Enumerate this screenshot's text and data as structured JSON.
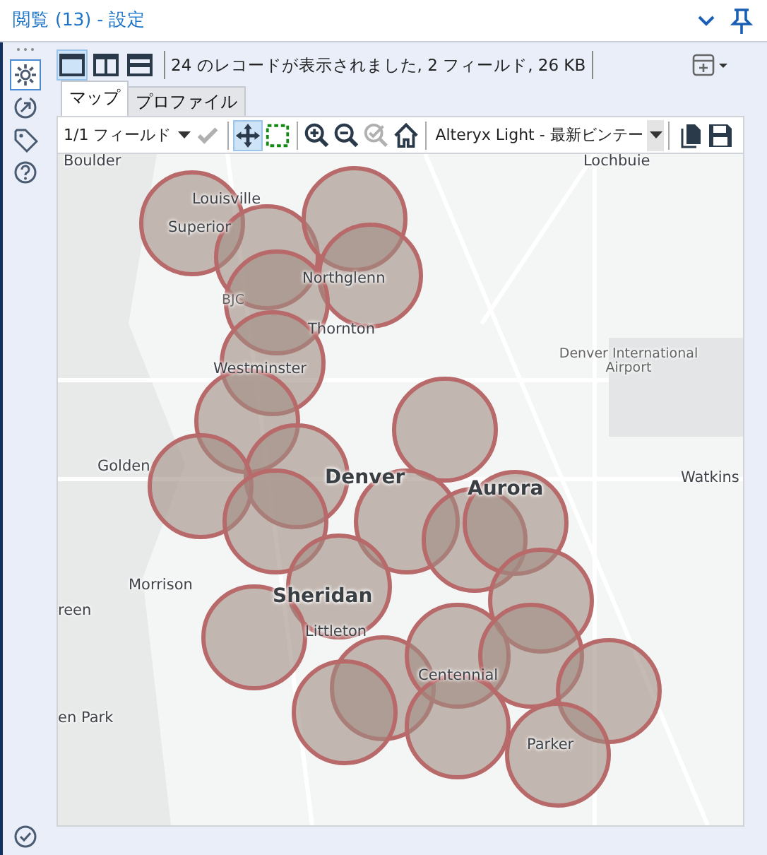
{
  "header": {
    "title": "閲覧 (13) - 設定"
  },
  "side_icons": [
    {
      "kind": "gear",
      "selected": true
    },
    {
      "kind": "arrow",
      "selected": false
    },
    {
      "kind": "tag",
      "selected": false
    },
    {
      "kind": "help",
      "selected": false
    }
  ],
  "layout_buttons": [
    {
      "kind": "single",
      "selected": true
    },
    {
      "kind": "columns",
      "selected": false
    },
    {
      "kind": "rows",
      "selected": false
    }
  ],
  "status": "24 のレコードが表示されました, 2 フィールド, 26 KB",
  "tabs": [
    {
      "label": "マップ",
      "selected": true
    },
    {
      "label": "プロファイル",
      "selected": false
    }
  ],
  "field_select": {
    "value": "1/1 フィールド"
  },
  "tools": [
    {
      "kind": "apply",
      "disabled": true,
      "selected": false
    },
    {
      "kind": "pan",
      "disabled": false,
      "selected": true
    },
    {
      "kind": "select",
      "disabled": false,
      "selected": false
    },
    {
      "kind": "zoomin",
      "disabled": false,
      "selected": false
    },
    {
      "kind": "zoomout",
      "disabled": false,
      "selected": false
    },
    {
      "kind": "zoomsel",
      "disabled": true,
      "selected": false
    },
    {
      "kind": "home",
      "disabled": false,
      "selected": false
    }
  ],
  "basemap": {
    "value": "Alteryx Light - 最新ビンテー"
  },
  "map": {
    "labels": [
      {
        "text": "Boulder",
        "kind": "town"
      },
      {
        "text": "Lochbuie",
        "kind": "town"
      },
      {
        "text": "Louisville",
        "kind": "town"
      },
      {
        "text": "Superior",
        "kind": "town"
      },
      {
        "text": "BJC",
        "kind": "airport"
      },
      {
        "text": "Northglenn",
        "kind": "town"
      },
      {
        "text": "Thornton",
        "kind": "town"
      },
      {
        "text": "Westminster",
        "kind": "town"
      },
      {
        "text": "Denver International Airport",
        "kind": "airport"
      },
      {
        "text": "Golden",
        "kind": "town"
      },
      {
        "text": "Denver",
        "kind": "city"
      },
      {
        "text": "Aurora",
        "kind": "city"
      },
      {
        "text": "Watkins",
        "kind": "town"
      },
      {
        "text": "Morrison",
        "kind": "town"
      },
      {
        "text": "Sheridan",
        "kind": "city"
      },
      {
        "text": "Littleton",
        "kind": "town"
      },
      {
        "text": "reen",
        "kind": "town"
      },
      {
        "text": "en Park",
        "kind": "town"
      },
      {
        "text": "Centennial",
        "kind": "town"
      },
      {
        "text": "Parker",
        "kind": "town"
      }
    ]
  }
}
